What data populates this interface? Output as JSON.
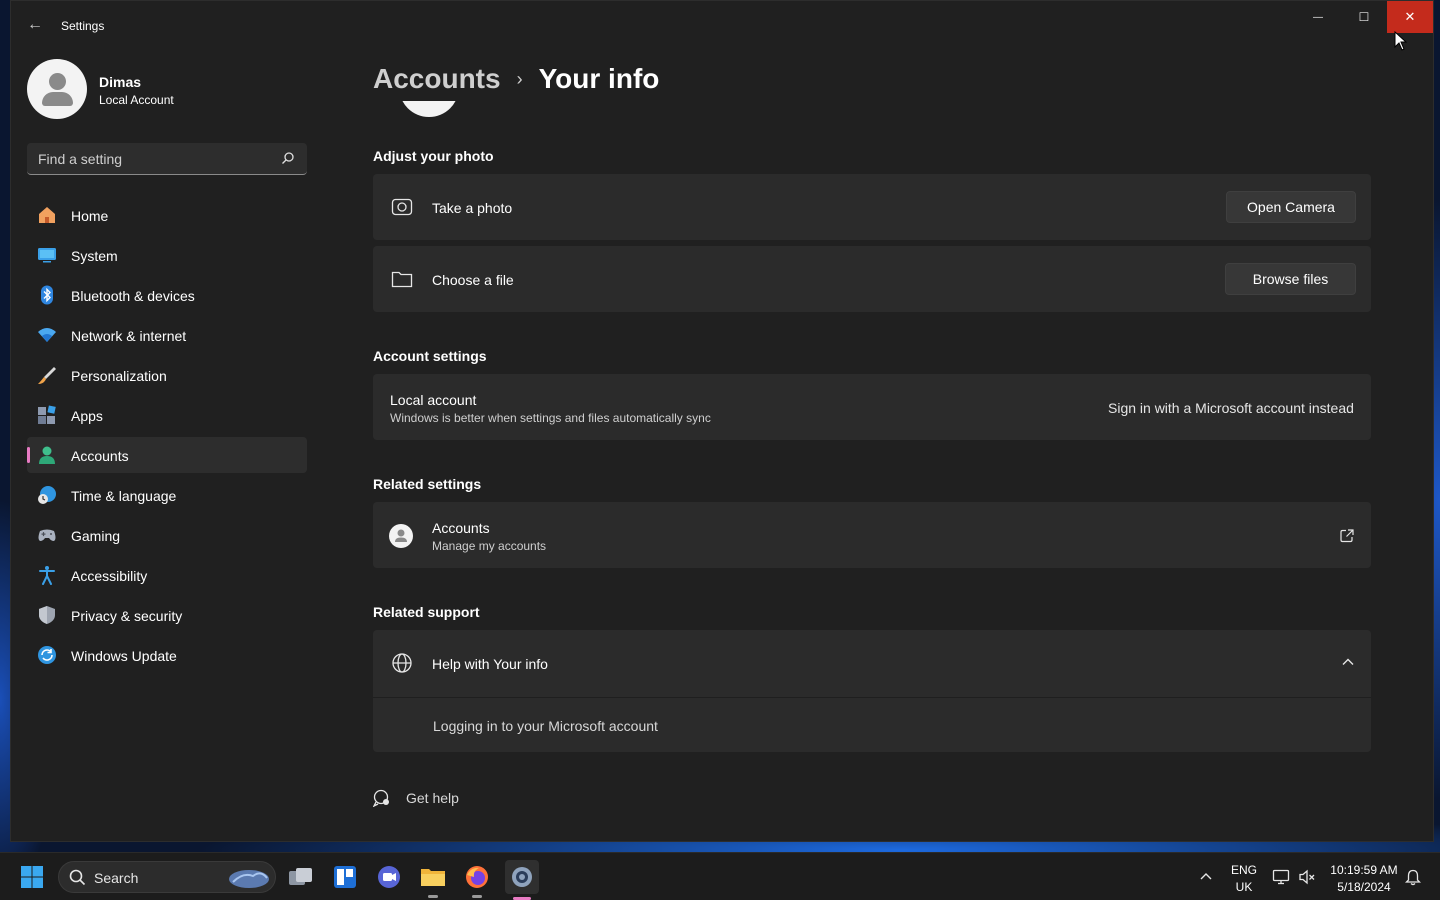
{
  "window": {
    "title": "Settings",
    "back_glyph": "←",
    "minimize_glyph": "—",
    "maximize_glyph": "☐",
    "close_glyph": "✕"
  },
  "profile": {
    "name": "Dimas",
    "account_type": "Local Account"
  },
  "search": {
    "placeholder": "Find a setting"
  },
  "sidebar": {
    "items": [
      {
        "label": "Home",
        "icon": "home-icon"
      },
      {
        "label": "System",
        "icon": "system-icon"
      },
      {
        "label": "Bluetooth & devices",
        "icon": "bluetooth-icon"
      },
      {
        "label": "Network & internet",
        "icon": "wifi-icon"
      },
      {
        "label": "Personalization",
        "icon": "brush-icon"
      },
      {
        "label": "Apps",
        "icon": "apps-icon"
      },
      {
        "label": "Accounts",
        "icon": "accounts-icon",
        "active": true
      },
      {
        "label": "Time & language",
        "icon": "globe-clock-icon"
      },
      {
        "label": "Gaming",
        "icon": "gamepad-icon"
      },
      {
        "label": "Accessibility",
        "icon": "accessibility-icon"
      },
      {
        "label": "Privacy & security",
        "icon": "shield-icon"
      },
      {
        "label": "Windows Update",
        "icon": "update-icon"
      }
    ]
  },
  "main": {
    "breadcrumb_parent": "Accounts",
    "breadcrumb_separator": "›",
    "breadcrumb_current": "Your info",
    "adjust_photo": {
      "heading": "Adjust your photo",
      "take_photo_label": "Take a photo",
      "open_camera_button": "Open Camera",
      "choose_file_label": "Choose a file",
      "browse_files_button": "Browse files"
    },
    "account_settings": {
      "heading": "Account settings",
      "title": "Local account",
      "subtitle": "Windows is better when settings and files automatically sync",
      "action_link": "Sign in with a Microsoft account instead"
    },
    "related_settings": {
      "heading": "Related settings",
      "title": "Accounts",
      "subtitle": "Manage my accounts"
    },
    "related_support": {
      "heading": "Related support",
      "help_title": "Help with Your info",
      "help_link": "Logging in to your Microsoft account"
    },
    "get_help": "Get help"
  },
  "taskbar": {
    "search_label": "Search",
    "language_top": "ENG",
    "language_bottom": "UK",
    "time": "10:19:59 AM",
    "date": "5/18/2024"
  },
  "colors": {
    "accent_active_indicator": "#e87bc3",
    "close_button": "#c42b1c",
    "window_bg": "#202020",
    "card_bg": "#2b2b2b"
  }
}
